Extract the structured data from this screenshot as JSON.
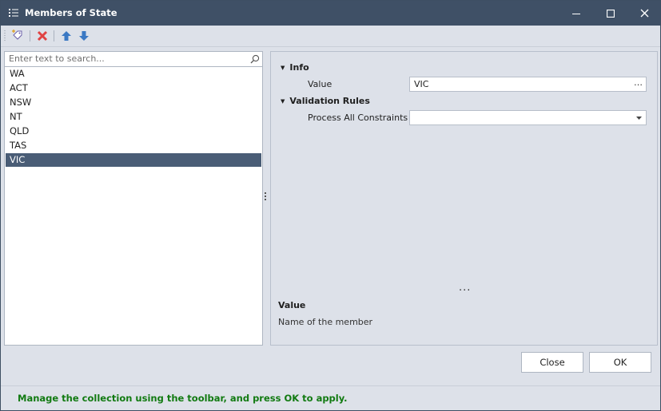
{
  "window": {
    "title": "Members of State"
  },
  "toolbar": {
    "add_icon": "add-tag-icon",
    "delete_icon": "delete-icon",
    "move_up_icon": "arrow-up-icon",
    "move_down_icon": "arrow-down-icon"
  },
  "search": {
    "placeholder": "Enter text to search..."
  },
  "members": [
    "WA",
    "ACT",
    "NSW",
    "NT",
    "QLD",
    "TAS",
    "VIC"
  ],
  "selected_member": "VIC",
  "properties": {
    "info_category": "Info",
    "value_label": "Value",
    "value": "VIC",
    "value_button": "…",
    "validation_category": "Validation Rules",
    "process_label": "Process All Constraints",
    "process_value": ""
  },
  "description": {
    "dots": "...",
    "title": "Value",
    "text": "Name of the member"
  },
  "buttons": {
    "close": "Close",
    "ok": "OK"
  },
  "footer": {
    "message": "Manage the collection using the toolbar, and press OK to apply."
  },
  "colors": {
    "titlebar": "#3f5066",
    "selection": "#4a5d76",
    "footer_text": "#117a11",
    "delete": "#e04343",
    "arrows": "#3b79c4"
  }
}
